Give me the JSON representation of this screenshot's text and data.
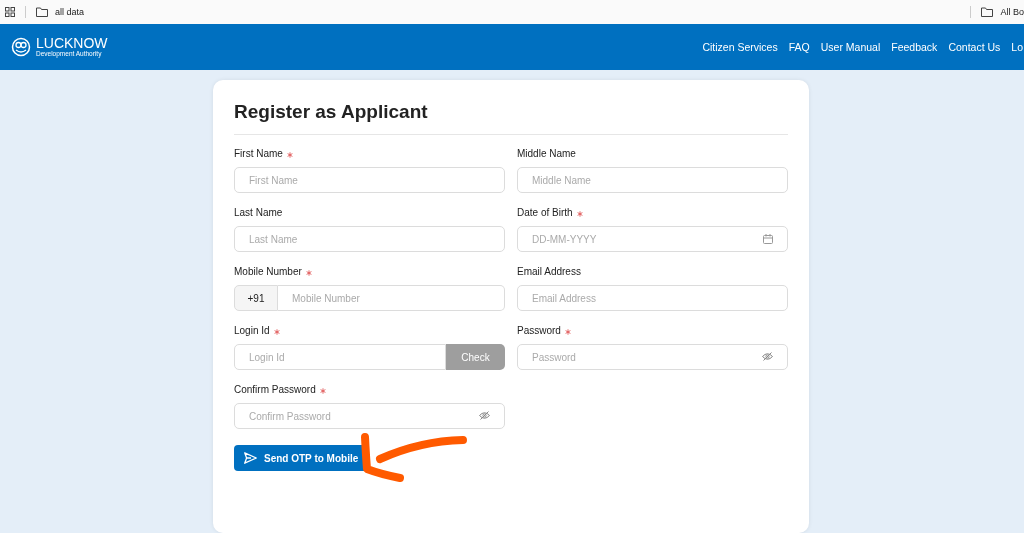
{
  "bookmarks_bar": {
    "left": [
      {
        "kind": "apps"
      },
      {
        "kind": "folder",
        "label": "all data"
      }
    ],
    "right": [
      {
        "kind": "folder",
        "label": "All Bo"
      }
    ]
  },
  "header": {
    "logo_title": "LUCKNOW",
    "logo_subtitle": "Development Authority",
    "nav": [
      "Citizen Services",
      "FAQ",
      "User Manual",
      "Feedback",
      "Contact Us",
      "Lo"
    ]
  },
  "form": {
    "title": "Register as Applicant",
    "fields": [
      {
        "label": "First Name",
        "required": true,
        "placeholder": "First Name",
        "kind": "text"
      },
      {
        "label": "Middle Name",
        "required": false,
        "placeholder": "Middle Name",
        "kind": "text"
      },
      {
        "label": "Last Name",
        "required": false,
        "placeholder": "Last Name",
        "kind": "text"
      },
      {
        "label": "Date of Birth",
        "required": true,
        "placeholder": "DD-MM-YYYY",
        "kind": "date"
      },
      {
        "label": "Mobile Number",
        "required": true,
        "placeholder": "Mobile Number",
        "kind": "phone",
        "prefix": "+91"
      },
      {
        "label": "Email Address",
        "required": false,
        "placeholder": "Email Address",
        "kind": "text"
      },
      {
        "label": "Login Id",
        "required": true,
        "placeholder": "Login Id",
        "kind": "check",
        "button": "Check"
      },
      {
        "label": "Password",
        "required": true,
        "placeholder": "Password",
        "kind": "password"
      },
      {
        "label": "Confirm Password",
        "required": true,
        "placeholder": "Confirm Password",
        "kind": "password"
      }
    ],
    "submit": "Send OTP to Mobile"
  },
  "annotation": {
    "kind": "arrow"
  }
}
